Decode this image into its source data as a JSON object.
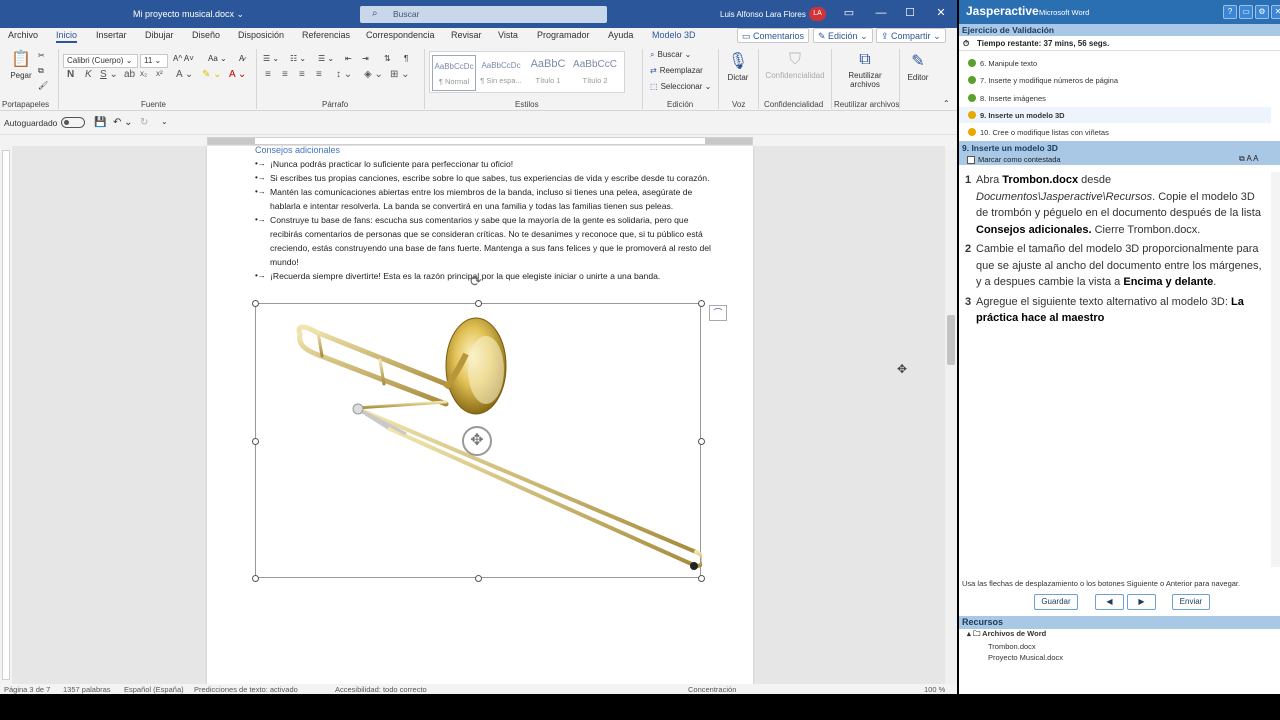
{
  "word": {
    "doc_title": "Mi proyecto musical.docx",
    "search_placeholder": "Buscar",
    "user_name": "Luis Alfonso Lara Flores",
    "user_initials": "LA",
    "tabs": [
      "Archivo",
      "Inicio",
      "Insertar",
      "Dibujar",
      "Diseño",
      "Disposición",
      "Referencias",
      "Correspondencia",
      "Revisar",
      "Vista",
      "Programador",
      "Ayuda",
      "Modelo 3D"
    ],
    "ribbon_right": {
      "comments": "Comentarios",
      "editing": "Edición",
      "share": "Compartir"
    },
    "ribbon": {
      "paste": "Pegar",
      "font_name": "Calibri (Cuerpo)",
      "font_size": "11",
      "styles": [
        {
          "sample": "AaBbCcDc",
          "name": "¶ Normal"
        },
        {
          "sample": "AaBbCcDc",
          "name": "¶ Sin espa..."
        },
        {
          "sample": "AaBbC",
          "name": "Título 1"
        },
        {
          "sample": "AaBbCcC",
          "name": "Título 2"
        }
      ],
      "find": "Buscar",
      "replace": "Reemplazar",
      "select": "Seleccionar",
      "dictate": "Dictar",
      "sensitivity": "Confidencialidad",
      "reuse": "Reutilizar archivos",
      "editor": "Editor",
      "groups": [
        "Portapapeles",
        "Fuente",
        "Párrafo",
        "Estilos",
        "Edición",
        "Voz",
        "Confidencialidad",
        "Reutilizar archivos"
      ]
    },
    "autosave_label": "Autoguardado",
    "document": {
      "heading": "Consejos adicionales",
      "bullets": [
        "¡Nunca podrás practicar lo suficiente para perfeccionar tu oficio!",
        "Si escribes tus propias canciones, escribe sobre lo que sabes, tus experiencias de vida y escribe desde tu corazón.",
        "Mantén las comunicaciones abiertas entre los miembros de la banda, incluso si tienes una pelea, asegúrate de hablarla e intentar resolverla. La banda se convertirá en una familia y todas las familias tienen sus peleas.",
        "Construye tu base de fans: escucha sus comentarios y sabe que la mayoría de la gente es solidaria, pero que recibirás comentarios de personas que se consideran críticas. No te desanimes y reconoce que, si tu público está creciendo, estás construyendo una base de fans fuerte. Mantenga a sus fans felices y que le promoverá al resto del mundo!",
        "¡Recuerda siempre divertirte! Esta es la razón principal por la que elegiste iniciar o unirte a una banda."
      ]
    },
    "status": {
      "page": "Página 3 de 7",
      "words": "1357 palabras",
      "language": "Español (España)",
      "predictions": "Predicciones de texto: activado",
      "accessibility": "Accesibilidad: todo correcto",
      "focus": "Concentración",
      "zoom": "100 %"
    }
  },
  "panel": {
    "brand": "Jasperactive",
    "app": "Microsoft Word",
    "section_title": "Ejercicio de Validación",
    "timer": "Tiempo restante: 37 mins, 56 segs.",
    "tasks": [
      {
        "label": "6. Manipule texto",
        "status": "green"
      },
      {
        "label": "7. Inserte y modifique números de página",
        "status": "green"
      },
      {
        "label": "8. Inserte imágenes",
        "status": "green"
      },
      {
        "label": "9. Inserte un modelo 3D",
        "status": "yellow"
      },
      {
        "label": "10. Cree o modifique listas con viñetas",
        "status": "yellow"
      }
    ],
    "current_task_title": "9. Inserte un modelo 3D",
    "mark_answered": "Marcar como contestada",
    "steps": [
      {
        "n": "1",
        "parts": [
          "Abra ",
          "Trombon.docx",
          " desde ",
          "Documentos\\Jasperactive\\Recursos",
          ". Copie el modelo 3D de trombón y péguelo en el documento después de la lista ",
          "Consejos adicionales.",
          " Cierre Trombon.docx."
        ]
      },
      {
        "n": "2",
        "parts": [
          "Cambie el tamaño del modelo 3D proporcionalmente para que se ajuste  al ancho del documento entre los márgenes, y a despues cambie la vista a ",
          "Encima y delante",
          "."
        ]
      },
      {
        "n": "3",
        "parts": [
          "Agregue el siguiente texto alternativo al modelo 3D: ",
          "La práctica hace al maestro"
        ]
      }
    ],
    "nav_hint": "Usa las flechas de desplazamiento o los botones Siguiente o Anterior para navegar.",
    "save": "Guardar",
    "submit": "Enviar",
    "resources_title": "Recursos",
    "resources_folder": "Archivos de Word",
    "resources": [
      "Trombon.docx",
      "Proyecto Musical.docx"
    ]
  }
}
